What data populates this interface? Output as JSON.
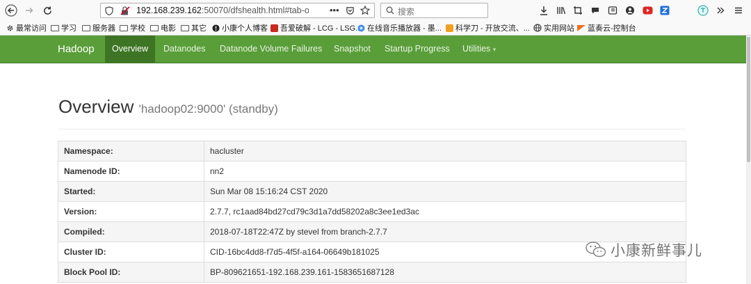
{
  "browser": {
    "url_host": "192.168.239.162",
    "url_rest": ":50070/dfshealth.html#tab-over",
    "url_more": "•••",
    "search_placeholder": "搜索",
    "bookmarks": [
      {
        "label": "最常访问",
        "icon": "gear-icon"
      },
      {
        "label": "学习",
        "icon": "folder-icon"
      },
      {
        "label": "服务器",
        "icon": "folder-icon"
      },
      {
        "label": "学校",
        "icon": "folder-icon"
      },
      {
        "label": "电影",
        "icon": "folder-icon"
      },
      {
        "label": "其它",
        "icon": "folder-icon"
      },
      {
        "label": "小康个人博客",
        "icon": "site-icon"
      },
      {
        "label": "吾爱破解 - LCG - LSG...",
        "icon": "site-icon"
      },
      {
        "label": "在线音乐播放器 - 墨...",
        "icon": "site-icon"
      },
      {
        "label": "科学刀 - 开放交流、...",
        "icon": "site-icon"
      },
      {
        "label": "实用网站",
        "icon": "globe-icon"
      },
      {
        "label": "蓝奏云-控制台",
        "icon": "site-icon"
      }
    ]
  },
  "navbar": {
    "brand": "Hadoop",
    "items": [
      "Overview",
      "Datanodes",
      "Datanode Volume Failures",
      "Snapshot",
      "Startup Progress",
      "Utilities"
    ],
    "utilities_caret": "▾"
  },
  "page": {
    "title": "Overview",
    "subtitle": "'hadoop02:9000' (standby)"
  },
  "table": [
    {
      "key": "Namespace:",
      "value": "hacluster"
    },
    {
      "key": "Namenode ID:",
      "value": "nn2"
    },
    {
      "key": "Started:",
      "value": "Sun Mar 08 15:16:24 CST 2020"
    },
    {
      "key": "Version:",
      "value": "2.7.7, rc1aad84bd27cd79c3d1a7dd58202a8c3ee1ed3ac"
    },
    {
      "key": "Compiled:",
      "value": "2018-07-18T22:47Z by stevel from branch-2.7.7"
    },
    {
      "key": "Cluster ID:",
      "value": "CID-16bc4dd8-f7d5-4f5f-a164-06649b181025"
    },
    {
      "key": "Block Pool ID:",
      "value": "BP-809621651-192.168.239.161-1583651687128"
    }
  ],
  "watermark": "小康新鲜事儿",
  "colors": {
    "navbar": "#5a9e3a",
    "nav_active": "#3e7525"
  }
}
